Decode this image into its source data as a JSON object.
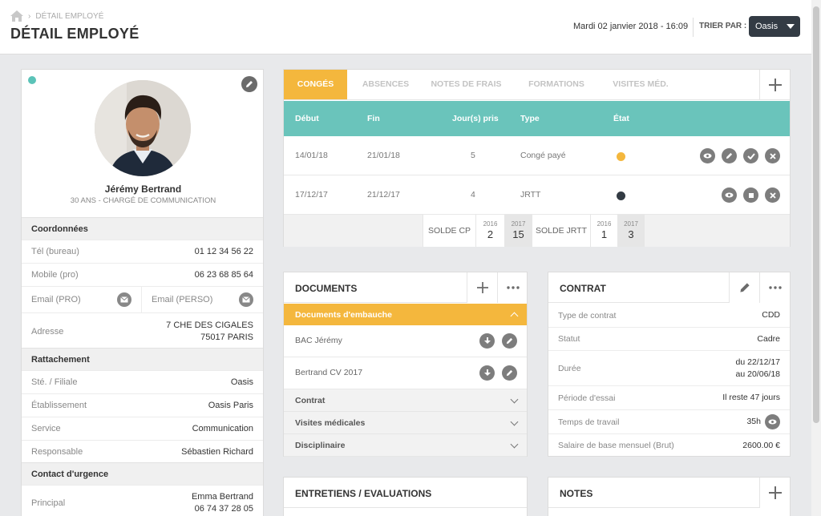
{
  "header": {
    "breadcrumb": "DÉTAIL EMPLOYÉ",
    "title": "DÉTAIL EMPLOYÉ",
    "datetime": "Mardi 02 janvier 2018 - 16:09",
    "sort_label": "TRIER PAR :",
    "sort_value": "Oasis"
  },
  "profile": {
    "name": "Jérémy Bertrand",
    "subtitle": "30 ANS - CHARGÉ DE COMMUNICATION",
    "sections": {
      "coordonnees": "Coordonnées",
      "rattachement": "Rattachement",
      "urgence": "Contact d'urgence"
    },
    "tel_label": "Tél (bureau)",
    "tel_value": "01 12 34 56 22",
    "mobile_label": "Mobile (pro)",
    "mobile_value": "06 23 68 85 64",
    "email_pro_label": "Email (PRO)",
    "email_perso_label": "Email (PERSO)",
    "adresse_label": "Adresse",
    "adresse_line1": "7 CHE DES CIGALES",
    "adresse_line2": "75017 PARIS",
    "ste_label": "Sté. / Filiale",
    "ste_value": "Oasis",
    "etab_label": "Établissement",
    "etab_value": "Oasis Paris",
    "service_label": "Service",
    "service_value": "Communication",
    "resp_label": "Responsable",
    "resp_value": "Sébastien Richard",
    "principal_label": "Principal",
    "principal_name": "Emma Bertrand",
    "principal_phone": "06 74 37 28 05"
  },
  "tabs": [
    "CONGÉS",
    "ABSENCES",
    "NOTES DE FRAIS",
    "FORMATIONS",
    "VISITES MÉD."
  ],
  "conges": {
    "columns": [
      "Début",
      "Fin",
      "Jour(s) pris",
      "Type",
      "État"
    ],
    "rows": [
      {
        "debut": "14/01/18",
        "fin": "21/01/18",
        "jours": "5",
        "type": "Congé payé",
        "state_color": "#f4b73d"
      },
      {
        "debut": "17/12/17",
        "fin": "21/12/17",
        "jours": "4",
        "type": "JRTT",
        "state_color": "#333b44"
      }
    ],
    "solde_cp_label": "SOLDE CP",
    "solde_cp": [
      {
        "year": "2016",
        "value": "2"
      },
      {
        "year": "2017",
        "value": "15"
      }
    ],
    "solde_jrtt_label": "SOLDE JRTT",
    "solde_jrtt": [
      {
        "year": "2016",
        "value": "1"
      },
      {
        "year": "2017",
        "value": "3"
      }
    ]
  },
  "documents": {
    "title": "DOCUMENTS",
    "open_section": "Documents d'embauche",
    "files": [
      "BAC Jérémy",
      "Bertrand CV 2017"
    ],
    "closed_sections": [
      "Contrat",
      "Visites médicales",
      "Disciplinaire"
    ]
  },
  "contrat": {
    "title": "CONTRAT",
    "type_label": "Type de contrat",
    "type_value": "CDD",
    "statut_label": "Statut",
    "statut_value": "Cadre",
    "duree_label": "Durée",
    "duree_line1": "du 22/12/17",
    "duree_line2": "au 20/06/18",
    "essai_label": "Période d'essai",
    "essai_value": "Il reste 47 jours",
    "temps_label": "Temps de travail",
    "temps_value": "35h",
    "salaire_label": "Salaire de base mensuel (Brut)",
    "salaire_value": "2600.00 €"
  },
  "entretiens": {
    "title": "ENTRETIENS / EVALUATIONS"
  },
  "notes": {
    "title": "NOTES"
  },
  "colors": {
    "accent": "#f4b73d",
    "teal": "#6ac4bb",
    "dark": "#333b44"
  }
}
